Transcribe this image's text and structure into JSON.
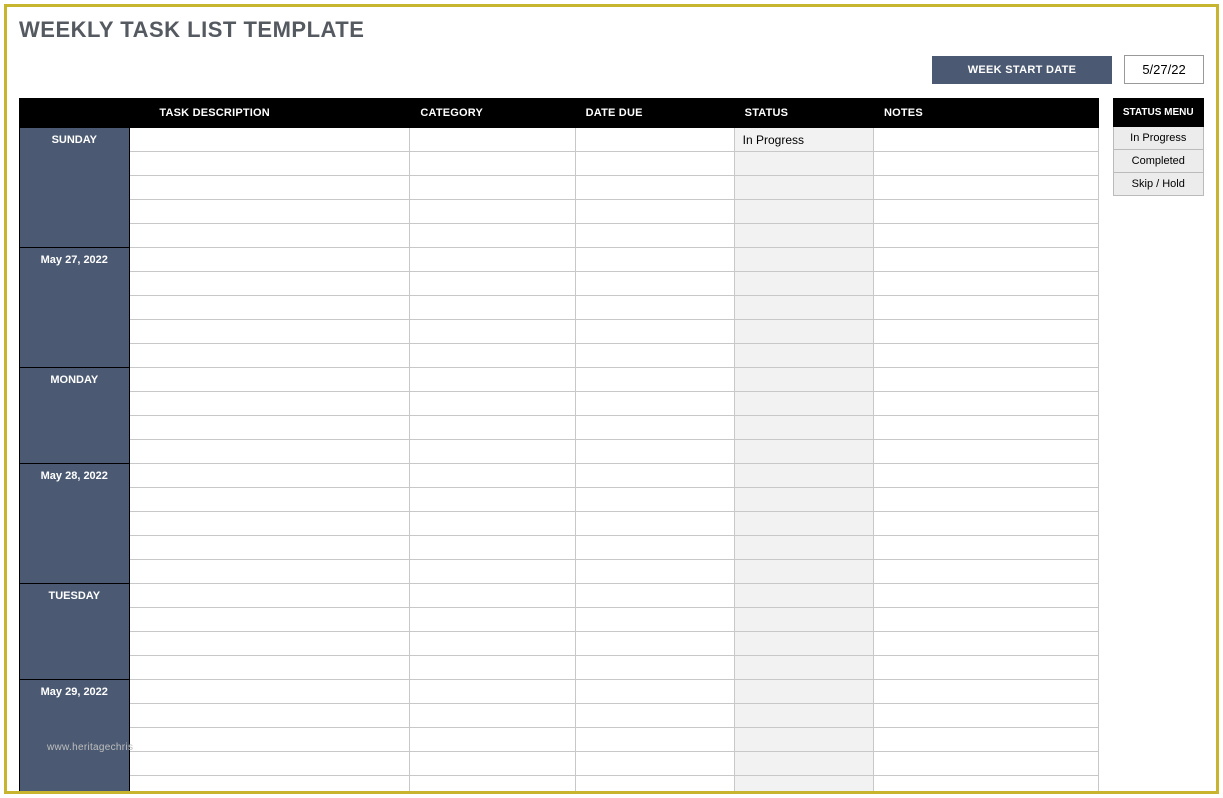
{
  "title": "WEEKLY TASK LIST TEMPLATE",
  "week_start_label": "WEEK START DATE",
  "week_start_value": "5/27/22",
  "columns": {
    "task": "TASK DESCRIPTION",
    "category": "CATEGORY",
    "due": "DATE DUE",
    "status": "STATUS",
    "notes": "NOTES"
  },
  "status_menu": {
    "header": "STATUS MENU",
    "items": [
      "In Progress",
      "Completed",
      "Skip / Hold"
    ]
  },
  "days": [
    {
      "name": "SUNDAY",
      "date": "May 27, 2022",
      "rows": [
        {
          "task": "",
          "category": "",
          "due": "",
          "status": "In Progress",
          "notes": ""
        },
        {
          "task": "",
          "category": "",
          "due": "",
          "status": "",
          "notes": ""
        },
        {
          "task": "",
          "category": "",
          "due": "",
          "status": "",
          "notes": ""
        },
        {
          "task": "",
          "category": "",
          "due": "",
          "status": "",
          "notes": ""
        },
        {
          "task": "",
          "category": "",
          "due": "",
          "status": "",
          "notes": ""
        },
        {
          "task": "",
          "category": "",
          "due": "",
          "status": "",
          "notes": ""
        },
        {
          "task": "",
          "category": "",
          "due": "",
          "status": "",
          "notes": ""
        },
        {
          "task": "",
          "category": "",
          "due": "",
          "status": "",
          "notes": ""
        },
        {
          "task": "",
          "category": "",
          "due": "",
          "status": "",
          "notes": ""
        },
        {
          "task": "",
          "category": "",
          "due": "",
          "status": "",
          "notes": ""
        }
      ]
    },
    {
      "name": "MONDAY",
      "date": "May 28, 2022",
      "rows": [
        {
          "task": "",
          "category": "",
          "due": "",
          "status": "",
          "notes": ""
        },
        {
          "task": "",
          "category": "",
          "due": "",
          "status": "",
          "notes": ""
        },
        {
          "task": "",
          "category": "",
          "due": "",
          "status": "",
          "notes": ""
        },
        {
          "task": "",
          "category": "",
          "due": "",
          "status": "",
          "notes": ""
        },
        {
          "task": "",
          "category": "",
          "due": "",
          "status": "",
          "notes": ""
        },
        {
          "task": "",
          "category": "",
          "due": "",
          "status": "",
          "notes": ""
        },
        {
          "task": "",
          "category": "",
          "due": "",
          "status": "",
          "notes": ""
        },
        {
          "task": "",
          "category": "",
          "due": "",
          "status": "",
          "notes": ""
        },
        {
          "task": "",
          "category": "",
          "due": "",
          "status": "",
          "notes": ""
        }
      ]
    },
    {
      "name": "TUESDAY",
      "date": "May 29, 2022",
      "rows": [
        {
          "task": "",
          "category": "",
          "due": "",
          "status": "",
          "notes": ""
        },
        {
          "task": "",
          "category": "",
          "due": "",
          "status": "",
          "notes": ""
        },
        {
          "task": "",
          "category": "",
          "due": "",
          "status": "",
          "notes": ""
        },
        {
          "task": "",
          "category": "",
          "due": "",
          "status": "",
          "notes": ""
        },
        {
          "task": "",
          "category": "",
          "due": "",
          "status": "",
          "notes": ""
        },
        {
          "task": "",
          "category": "",
          "due": "",
          "status": "",
          "notes": ""
        },
        {
          "task": "",
          "category": "",
          "due": "",
          "status": "",
          "notes": ""
        },
        {
          "task": "",
          "category": "",
          "due": "",
          "status": "",
          "notes": ""
        },
        {
          "task": "",
          "category": "",
          "due": "",
          "status": "",
          "notes": ""
        }
      ]
    }
  ],
  "watermark": "www.heritagechris"
}
